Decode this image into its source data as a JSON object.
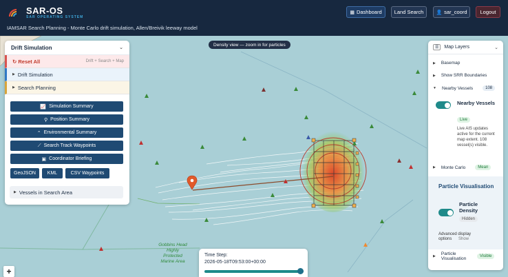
{
  "header": {
    "brand": "SAR-OS",
    "brand_sub": "SAR OPERATING SYSTEM",
    "subtitle": "IAMSAR Search Planning - Monte Carlo drift simulation, Allen/Breivik leeway model",
    "dashboard_label": "Dashboard",
    "land_search_label": "Land Search",
    "user_label": "sar_coord",
    "logout_label": "Logout"
  },
  "map": {
    "density_banner": "Density view — zoom in for particles",
    "mpa_label": "Gobbins Head Highly Protected Marine Area",
    "zoom_in": "+"
  },
  "left_panel": {
    "title": "Drift Simulation",
    "reset_label": "Reset All",
    "reset_hint": "Drift + Search + Map",
    "section_drift": "Drift Simulation",
    "section_search": "Search Planning",
    "buttons": [
      {
        "label": "Simulation Summary",
        "icon": "chart-icon"
      },
      {
        "label": "Position Summary",
        "icon": "pin-icon"
      },
      {
        "label": "Environmental Summary",
        "icon": "wind-icon"
      },
      {
        "label": "Search Track Waypoints",
        "icon": "track-icon"
      },
      {
        "label": "Coordinator Briefing",
        "icon": "document-icon"
      }
    ],
    "exports": [
      "GeoJSON",
      "KML",
      "CSV Waypoints"
    ],
    "vessels_section": "Vessels in Search Area"
  },
  "right_panel": {
    "title": "Map Layers",
    "basemap": "Basemap",
    "srr": "Show SRR Boundaries",
    "nearby_vessels": "Nearby Vessels",
    "nearby_count": "108",
    "nearby_toggle_label": "Nearby Vessels",
    "live_badge": "Live",
    "live_text": "Live AIS updates active for the current map extent. 108 vessel(s) visible.",
    "monte_carlo": "Monte Carlo",
    "monte_carlo_badge": "Mean",
    "particle_vis_title": "Particle Visualisation",
    "particle_density": "Particle Density",
    "hidden_badge": "Hidden",
    "advanced": "Advanced display options",
    "show": "Show",
    "particle_vis_row": "Particle Visualisation",
    "visible_badge": "Visible"
  },
  "time_step": {
    "label": "Time Step:",
    "value": "2026-05-18T09:53:00+00:00",
    "progress": 1.0
  },
  "colors": {
    "header_bg": "#17283f",
    "sea": "#a9cfd6",
    "accent": "#1f4a73",
    "danger": "#d9534f",
    "teal": "#1f8a8a"
  }
}
